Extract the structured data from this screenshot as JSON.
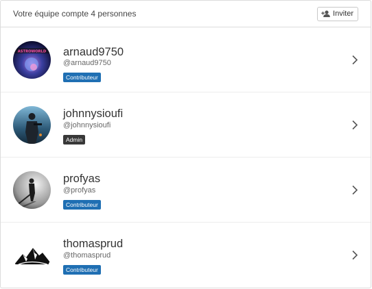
{
  "header": {
    "team_count_text": "Votre équipe compte 4 personnes",
    "invite_label": "Inviter"
  },
  "members": [
    {
      "name": "arnaud9750",
      "handle": "@arnaud9750",
      "role": "Contributeur",
      "avatar_text": "ASTROWORLD"
    },
    {
      "name": "johnnysioufi",
      "handle": "@johnnysioufi",
      "role": "Admin"
    },
    {
      "name": "profyas",
      "handle": "@profyas",
      "role": "Contributeur"
    },
    {
      "name": "thomasprud",
      "handle": "@thomasprud",
      "role": "Contributeur"
    }
  ],
  "colors": {
    "contributor_badge": "#1f6fb3",
    "admin_badge": "#383838",
    "border": "#dcdcdc"
  },
  "icons": {
    "invite": "add-user-icon",
    "row_action": "chevron-right-icon"
  }
}
